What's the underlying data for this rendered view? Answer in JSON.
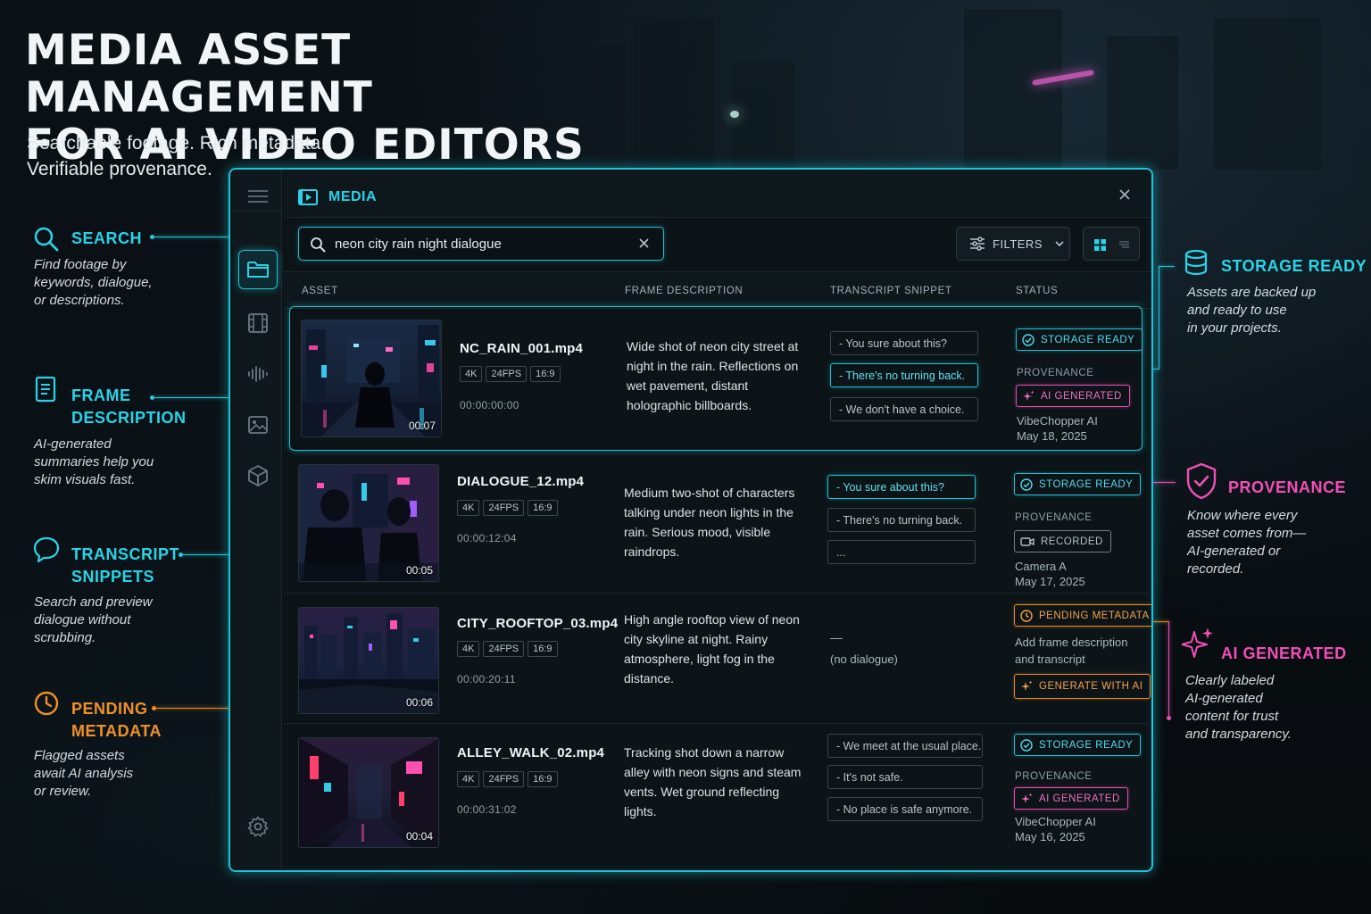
{
  "hero": {
    "title_line1": "MEDIA ASSET MANAGEMENT",
    "title_line2": "FOR AI VIDEO EDITORS",
    "sub_line1": "Searchable footage. Rich metadata.",
    "sub_line2": "Verifiable provenance."
  },
  "annotations": {
    "search": {
      "title": "SEARCH",
      "desc": [
        "Find footage by",
        "keywords, dialogue,",
        "or descriptions."
      ],
      "icon": "search-icon"
    },
    "frame": {
      "title": [
        "FRAME",
        "DESCRIPTION"
      ],
      "desc": [
        "AI-generated",
        "summaries help you",
        "skim visuals fast."
      ],
      "icon": "document-icon"
    },
    "transcript": {
      "title": [
        "TRANSCRIPT",
        "SNIPPETS"
      ],
      "desc": [
        "Search and preview",
        "dialogue without",
        "scrubbing."
      ],
      "icon": "speech-bubble-icon"
    },
    "pending": {
      "title": [
        "PENDING",
        "METADATA"
      ],
      "desc": [
        "Flagged assets",
        "await AI analysis",
        "or review."
      ],
      "icon": "clock-icon"
    },
    "storage": {
      "title": "STORAGE READY",
      "desc": [
        "Assets are backed up",
        "and ready to use",
        "in your projects."
      ],
      "icon": "database-icon"
    },
    "provenance": {
      "title": "PROVENANCE",
      "desc": [
        "Know where every",
        "asset comes from—",
        "AI-generated or",
        "recorded."
      ],
      "icon": "shield-check-icon"
    },
    "ai": {
      "title": "AI GENERATED",
      "desc": [
        "Clearly labeled",
        "AI-generated",
        "content for trust",
        "and transparency."
      ],
      "icon": "sparkle-icon"
    }
  },
  "app": {
    "section": "MEDIA",
    "search": {
      "value": "neon city rain night dialogue",
      "placeholder": ""
    },
    "filters_label": "FILTERS",
    "columns": {
      "asset": "ASSET",
      "frame": "FRAME DESCRIPTION",
      "transcript": "TRANSCRIPT SNIPPET",
      "status": "STATUS"
    },
    "rail": [
      "menu-icon",
      "folder-icon",
      "film-icon",
      "waveform-icon",
      "image-icon",
      "cube-icon",
      "settings-icon"
    ]
  },
  "rows": [
    {
      "file": "NC_RAIN_001.mp4",
      "tags": [
        "4K",
        "24FPS",
        "16:9"
      ],
      "timecode": "00:00:00:00",
      "duration": "00:07",
      "desc": "Wide shot of neon city street at night in the rain. Reflections on wet pavement, distant holographic billboards.",
      "snippets": [
        "- You sure about this?",
        "- There's no turning back.",
        "- We don't have a choice."
      ],
      "status": "STORAGE READY",
      "prov_label": "PROVENANCE",
      "prov": "AI GENERATED",
      "source": "VibeChopper AI",
      "date": "May 18, 2025"
    },
    {
      "file": "DIALOGUE_12.mp4",
      "tags": [
        "4K",
        "24FPS",
        "16:9"
      ],
      "timecode": "00:00:12:04",
      "duration": "00:05",
      "desc": "Medium two-shot of characters talking under neon lights in the rain. Serious mood, visible raindrops.",
      "snippets": [
        "- You sure about this?",
        "- There's no turning back.",
        "..."
      ],
      "status": "STORAGE READY",
      "prov_label": "PROVENANCE",
      "prov": "RECORDED",
      "source": "Camera A",
      "date": "May 17, 2025"
    },
    {
      "file": "CITY_ROOFTOP_03.mp4",
      "tags": [
        "4K",
        "24FPS",
        "16:9"
      ],
      "timecode": "00:00:20:11",
      "duration": "00:06",
      "desc": "High angle rooftop view of neon city skyline at night. Rainy atmosphere, light fog in the distance.",
      "dash": "—",
      "no_dialogue": "(no dialogue)",
      "status": "PENDING METADATA",
      "note1": "Add frame description",
      "note2": "and transcript",
      "action": "GENERATE WITH AI"
    },
    {
      "file": "ALLEY_WALK_02.mp4",
      "tags": [
        "4K",
        "24FPS",
        "16:9"
      ],
      "timecode": "00:00:31:02",
      "duration": "00:04",
      "desc": "Tracking shot down a narrow alley with neon signs and steam vents. Wet ground reflecting lights.",
      "snippets": [
        "- We meet at the usual place.",
        "- It's not safe.",
        "- No place is safe anymore."
      ],
      "status": "STORAGE READY",
      "prov_label": "PROVENANCE",
      "prov": "AI GENERATED",
      "source": "VibeChopper AI",
      "date": "May 16, 2025"
    }
  ],
  "colors": {
    "cyan": "#1fc2d6",
    "orange": "#f08a22",
    "pink": "#ec4db4",
    "bg": "#0b1217"
  }
}
